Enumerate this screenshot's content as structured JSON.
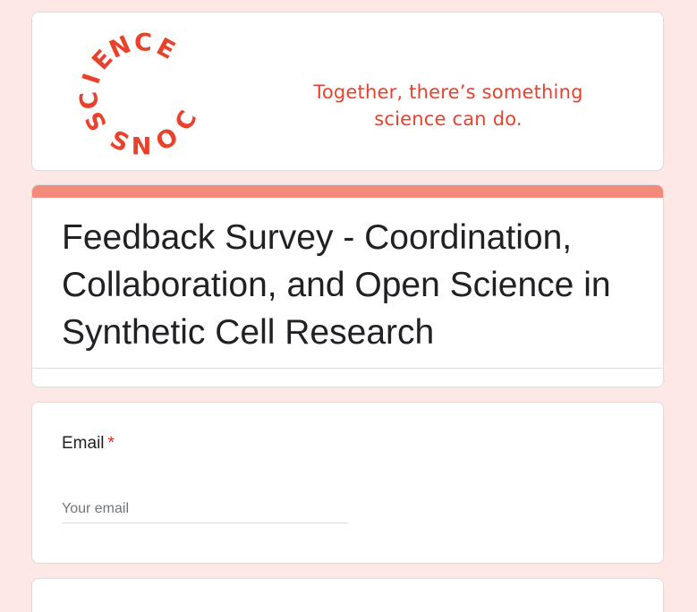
{
  "banner": {
    "logo_letters": [
      "S",
      "C",
      "I",
      "E",
      "N",
      "C",
      "E",
      "C",
      "O",
      "N",
      "S"
    ],
    "tagline_line1": "Together, there’s something",
    "tagline_line2": "science can do.",
    "brand_color": "#e8412c"
  },
  "form": {
    "title": "Feedback Survey - Coordination, Collaboration, and Open Science in Synthetic Cell Research",
    "accent_color": "#f48a7b"
  },
  "email_question": {
    "label": "Email",
    "required_marker": "*",
    "placeholder": "Your email",
    "value": ""
  },
  "theme": {
    "background": "#fde8e5",
    "card": "#ffffff"
  }
}
